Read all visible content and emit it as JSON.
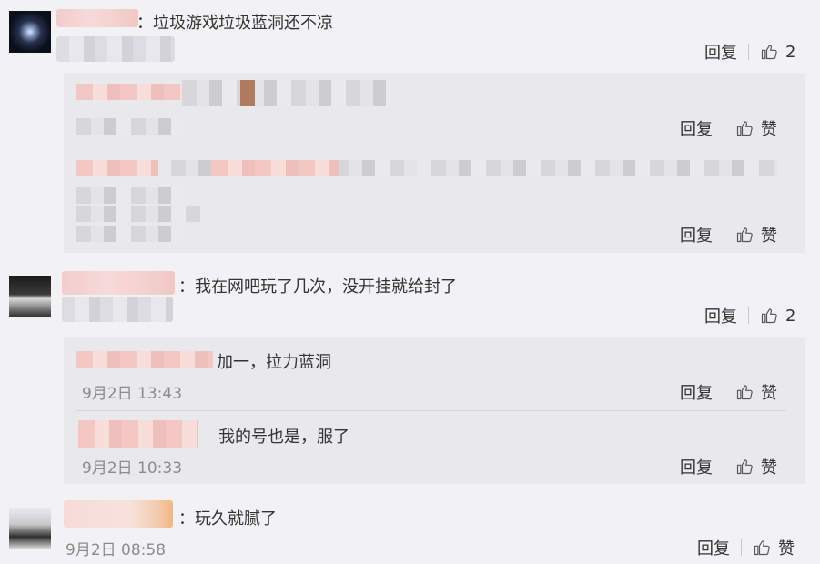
{
  "comments": [
    {
      "text": "：垃圾游戏垃圾蓝洞还不凉",
      "reply_label": "回复",
      "like_count": "2",
      "replies": [
        {
          "reply_label": "回复",
          "like_label": "赞"
        },
        {
          "reply_label": "回复",
          "like_label": "赞"
        }
      ]
    },
    {
      "text": "：我在网吧玩了几次，没开挂就给封了",
      "reply_label": "回复",
      "like_count": "2",
      "replies": [
        {
          "text": "加一，拉力蓝洞",
          "date": "9月2日 13:43",
          "reply_label": "回复",
          "like_label": "赞"
        },
        {
          "text": "我的号也是，服了",
          "date": "9月2日 10:33",
          "reply_label": "回复",
          "like_label": "赞"
        }
      ]
    },
    {
      "text": "：玩久就腻了",
      "date": "9月2日 08:58",
      "reply_label": "回复",
      "like_label": "赞"
    }
  ],
  "icons": {
    "like": "thumbs-up-icon"
  },
  "colors": {
    "background": "#f2f2f5",
    "panel": "#e9e9ed",
    "muted_text": "#8c8c8c",
    "name_blur": "#f3cccc"
  }
}
